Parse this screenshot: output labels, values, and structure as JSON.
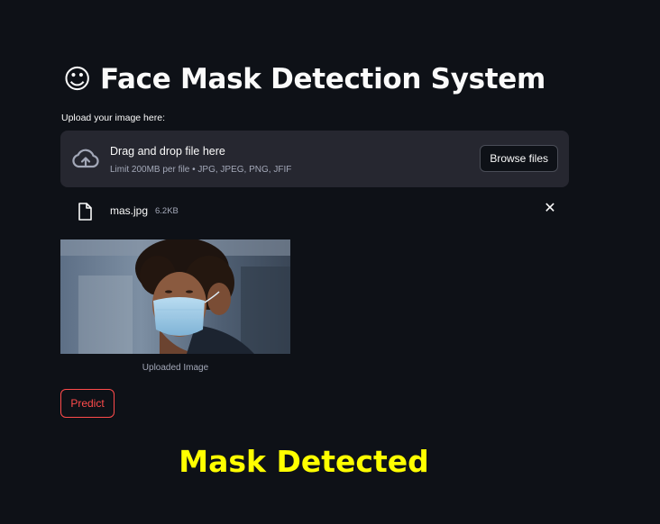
{
  "page": {
    "title_emoji": "☺",
    "title": "Face Mask Detection System"
  },
  "uploader": {
    "label": "Upload your image here:",
    "drop_title": "Drag and drop file here",
    "drop_limit": "Limit 200MB per file • JPG, JPEG, PNG, JFIF",
    "browse_label": "Browse files",
    "icon": "cloud-upload-icon"
  },
  "file": {
    "name": "mas.jpg",
    "size": "6.2KB",
    "icon": "file-icon",
    "remove_icon": "close-icon"
  },
  "image": {
    "caption": "Uploaded Image"
  },
  "actions": {
    "predict_label": "Predict"
  },
  "result": {
    "text": "Mask Detected",
    "color": "#ffff00"
  },
  "colors": {
    "background": "#0e1117",
    "dropzone": "#262730",
    "accent": "#ff4b4b"
  }
}
